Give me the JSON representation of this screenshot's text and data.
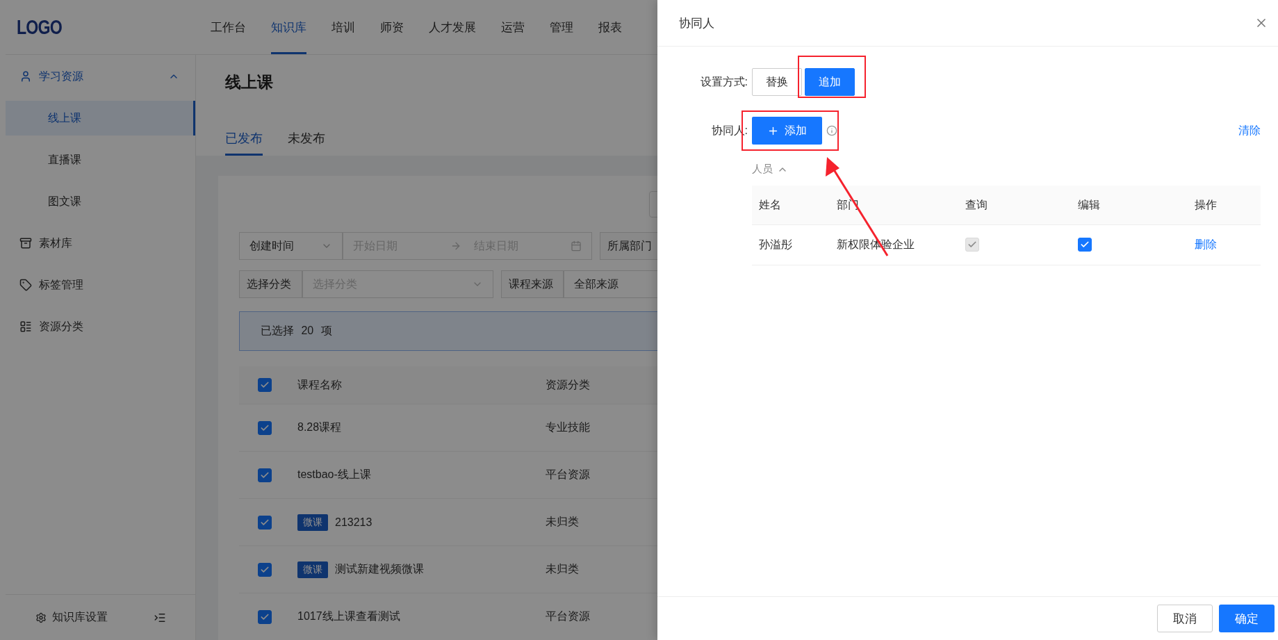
{
  "logo": "LOGO",
  "nav": [
    {
      "label": "工作台",
      "selected": false
    },
    {
      "label": "知识库",
      "selected": true
    },
    {
      "label": "培训",
      "selected": false
    },
    {
      "label": "师资",
      "selected": false
    },
    {
      "label": "人才发展",
      "selected": false
    },
    {
      "label": "运营",
      "selected": false
    },
    {
      "label": "管理",
      "selected": false
    },
    {
      "label": "报表",
      "selected": false
    }
  ],
  "sidebar": {
    "items": [
      {
        "label": "学习资源",
        "selected": true,
        "expanded": true,
        "children": [
          {
            "label": "线上课",
            "selected": true
          },
          {
            "label": "直播课",
            "selected": false
          },
          {
            "label": "图文课",
            "selected": false
          }
        ]
      },
      {
        "label": "素材库",
        "selected": false
      },
      {
        "label": "标签管理",
        "selected": false
      },
      {
        "label": "资源分类",
        "selected": false
      }
    ],
    "footer": "知识库设置"
  },
  "page": {
    "title": "线上课",
    "tabs": [
      {
        "label": "已发布",
        "selected": true
      },
      {
        "label": "未发布",
        "selected": false
      }
    ],
    "filters": {
      "time_select": "创建时间",
      "start_placeholder": "开始日期",
      "end_placeholder": "结束日期",
      "department_label": "所属部门",
      "category_label": "选择分类",
      "category_placeholder": "选择分类",
      "source_label": "课程来源",
      "source_value": "全部来源"
    },
    "selection": {
      "prefix": "已选择",
      "count": "20",
      "suffix": "项"
    },
    "table": {
      "all_checked": true,
      "columns": [
        "课程名称",
        "资源分类"
      ],
      "rows": [
        {
          "checked": true,
          "name": "8.28课程",
          "category": "专业技能"
        },
        {
          "checked": true,
          "name": "testbao-线上课",
          "category": "平台资源"
        },
        {
          "checked": true,
          "tag": "微课",
          "name": "213213",
          "category": "未归类"
        },
        {
          "checked": true,
          "tag": "微课",
          "name": "测试新建视频微课",
          "category": "未归类"
        },
        {
          "checked": true,
          "name": "1017线上课查看测试",
          "category": "平台资源"
        }
      ]
    }
  },
  "drawer": {
    "title": "协同人",
    "mode_label": "设置方式:",
    "modes": [
      {
        "label": "替换",
        "selected": false
      },
      {
        "label": "追加",
        "selected": true
      }
    ],
    "collaborator_label": "协同人:",
    "add_button": "添加",
    "clear_link": "清除",
    "section": {
      "label": "人员",
      "expanded": true
    },
    "table": {
      "columns": [
        "姓名",
        "部门",
        "查询",
        "编辑",
        "操作"
      ],
      "rows": [
        {
          "name": "孙溢彤",
          "department": "新权限体验企业",
          "query": {
            "checked": true,
            "disabled": true
          },
          "edit": {
            "checked": true,
            "disabled": false
          },
          "action": "删除"
        }
      ]
    },
    "cancel": "取消",
    "confirm": "确定"
  }
}
